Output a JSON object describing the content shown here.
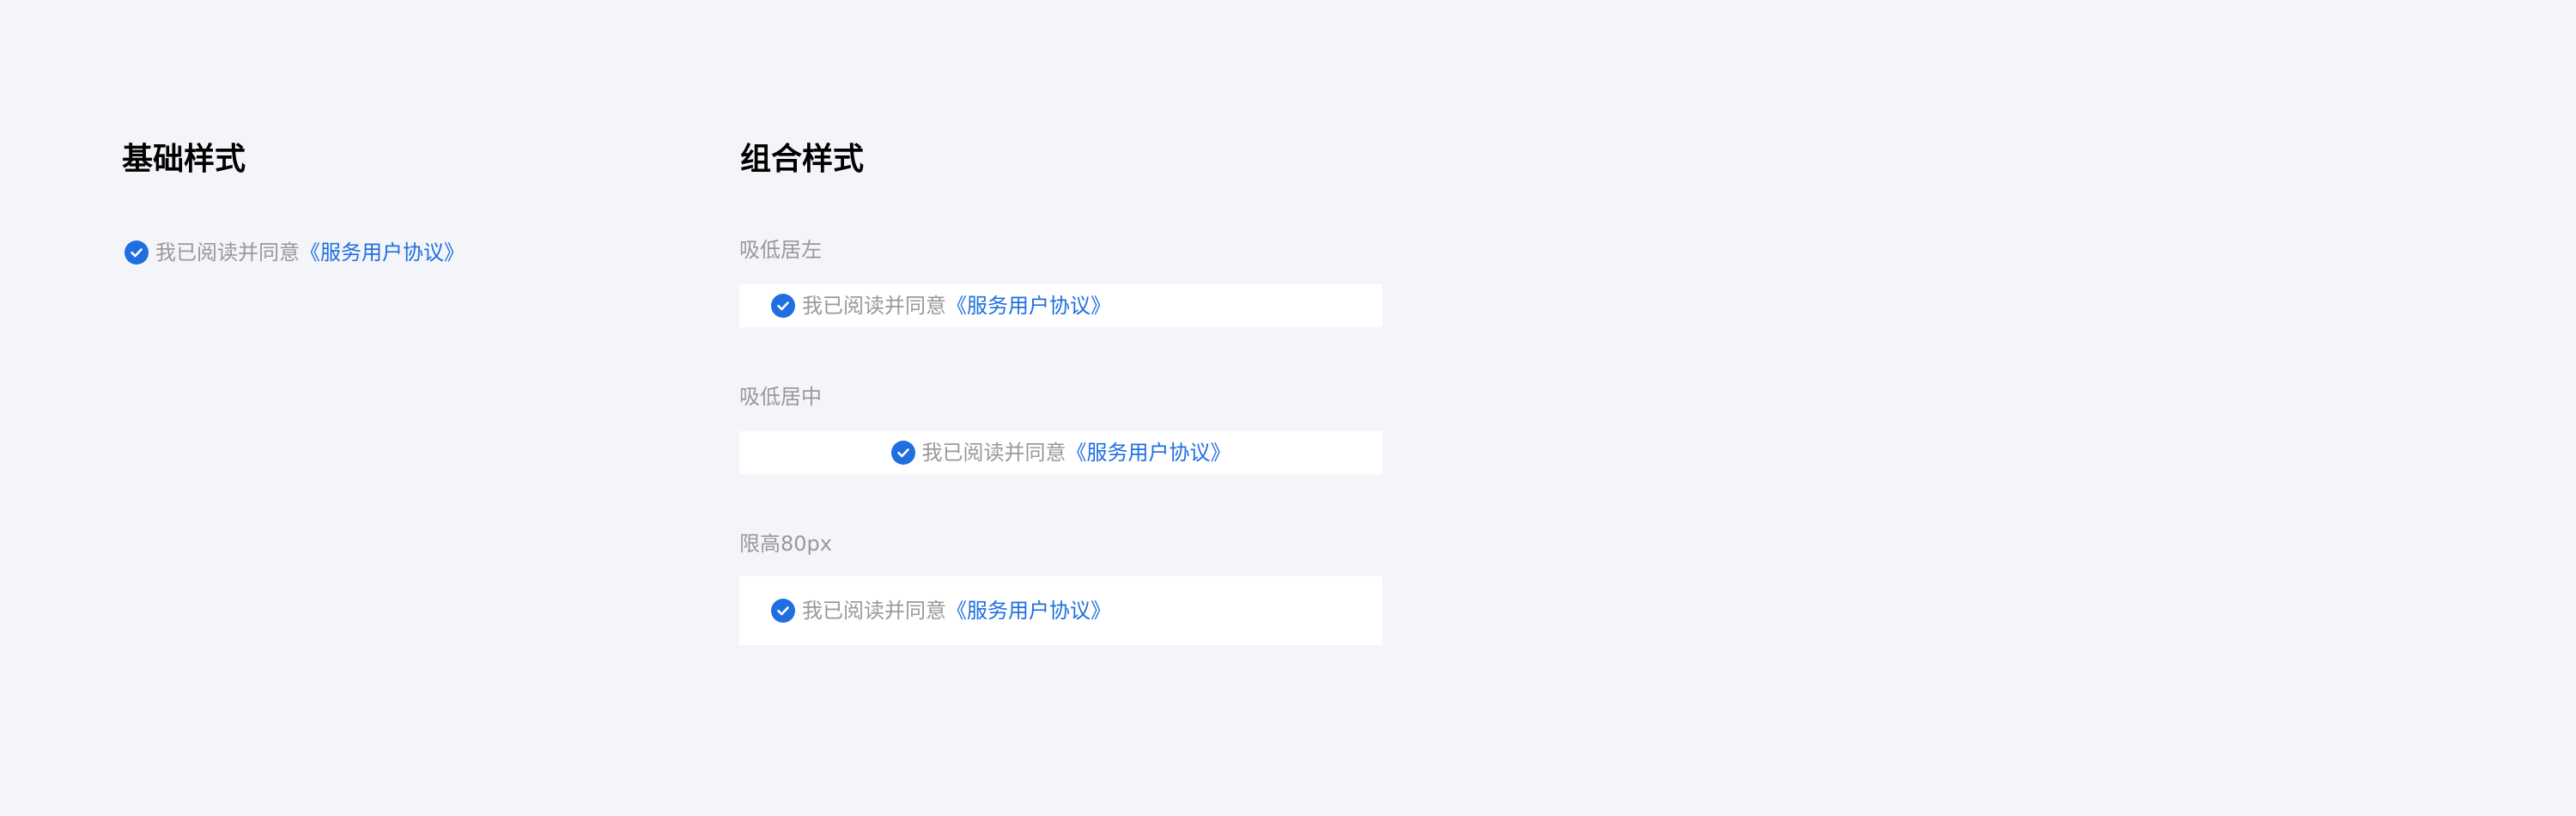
{
  "sections": {
    "basic_title": "基础样式",
    "combo_title": "组合样式"
  },
  "agreement": {
    "text": "我已阅读并同意",
    "link": "《服务用户协议》",
    "checked": true
  },
  "groups": [
    {
      "label": "吸低居左"
    },
    {
      "label": "吸低居中"
    },
    {
      "label": "限高80px"
    }
  ],
  "colors": {
    "background": "#f4f5f9",
    "accent": "#1f6fe0",
    "muted_text": "#999999",
    "title_text": "#000000",
    "panel": "#ffffff"
  },
  "icons": {
    "checkbox": "checked-circle-icon"
  }
}
